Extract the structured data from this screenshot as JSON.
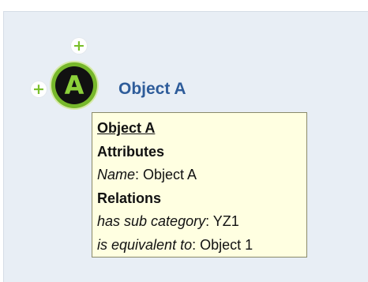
{
  "node": {
    "letter": "A",
    "label": "Object A",
    "expand_top_symbol": "+",
    "expand_left_symbol": "+"
  },
  "tooltip": {
    "title": "Object A",
    "attributes_heading": "Attributes",
    "attributes": [
      {
        "key": "Name",
        "value": "Object A"
      }
    ],
    "relations_heading": "Relations",
    "relations": [
      {
        "key": "has sub category",
        "value": "YZ1"
      },
      {
        "key": "is equivalent to",
        "value": "Object 1"
      }
    ]
  },
  "colors": {
    "canvas_background": "#e8eef5",
    "node_ring": "#77b82b",
    "node_fill": "#111111",
    "node_letter": "#8cd13a",
    "label": "#2e5c9a",
    "tooltip_background": "#ffffe1",
    "plus": "#7ac02b"
  }
}
